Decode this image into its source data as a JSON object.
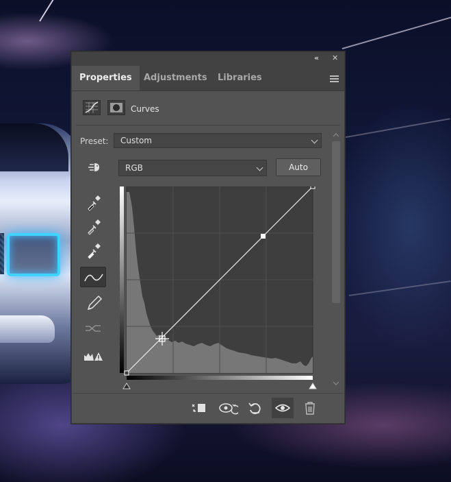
{
  "panel": {
    "tabs": [
      {
        "label": "Properties",
        "active": true
      },
      {
        "label": "Adjustments",
        "active": false
      },
      {
        "label": "Libraries",
        "active": false
      }
    ],
    "titlebar": {
      "collapse_glyph": "«",
      "close_glyph": "✕"
    },
    "header": {
      "title": "Curves",
      "icons": [
        "curves-adjustment-icon",
        "layer-mask-icon"
      ]
    },
    "preset": {
      "label": "Preset:",
      "value": "Custom"
    },
    "channel": {
      "value": "RGB"
    },
    "auto_label": "Auto",
    "tools": [
      "on-image-adjust-icon",
      "black-point-eyedropper-icon",
      "gray-point-eyedropper-icon",
      "white-point-eyedropper-icon",
      "curve-points-icon",
      "pencil-icon",
      "smooth-curve-icon",
      "clipping-warning-icon"
    ],
    "active_tool": "curve-points-icon",
    "footer_icons": [
      "clip-to-layer-icon",
      "view-previous-state-icon",
      "reset-icon",
      "visibility-eye-icon",
      "trash-icon"
    ],
    "colors": {
      "panel": "#535353",
      "tab_bar": "#424242",
      "graph_bg": "#3e3e3e",
      "histogram": "#777777"
    }
  },
  "curve": {
    "points": [
      [
        0,
        0
      ],
      [
        187,
        187
      ],
      [
        255,
        255
      ]
    ],
    "black_input": 0,
    "white_input": 255
  }
}
